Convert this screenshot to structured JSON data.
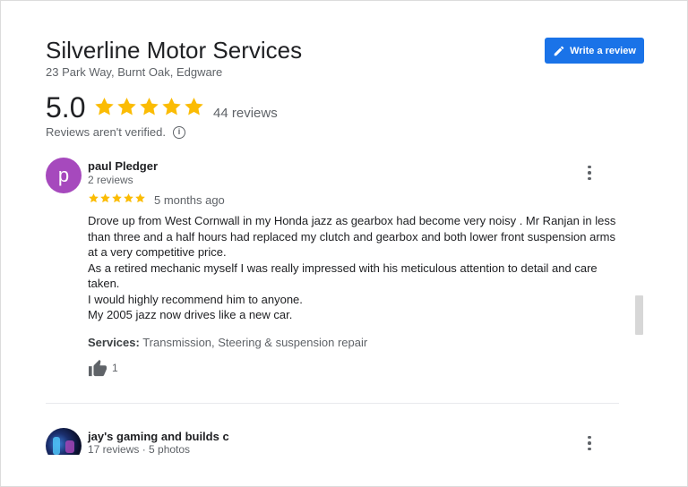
{
  "business": {
    "name": "Silverline Motor Services",
    "address": "23 Park Way, Burnt Oak, Edgware",
    "write_review_label": "Write a review",
    "rating": "5.0",
    "stars": 5,
    "review_count": "44 reviews",
    "not_verified": "Reviews aren't verified."
  },
  "reviews": [
    {
      "avatar_letter": "p",
      "avatar_color": "#a649bd",
      "name": "paul Pledger",
      "meta": "2 reviews",
      "stars": 5,
      "date": "5 months ago",
      "body": [
        "Drove up from West Cornwall in my Honda jazz as gearbox had become very noisy . Mr Ranjan in less than three and a half hours had replaced my clutch and gearbox and both lower front suspension arms at a very competitive price.",
        "As a retired mechanic myself I was really impressed with his meticulous attention to detail and care taken.",
        "I would highly recommend him to anyone.",
        "My 2005 jazz now drives like a new car."
      ],
      "services_label": "Services:",
      "services_value": "Transmission, Steering & suspension repair",
      "likes": "1"
    },
    {
      "name": "jay's gaming and builds c",
      "meta": "17 reviews · 5 photos"
    }
  ],
  "colors": {
    "accent": "#1a73e8",
    "star": "#fbbc04",
    "text": "#202124",
    "muted": "#5f6368"
  },
  "icons": {
    "write": "pencil-icon",
    "star": "star-icon",
    "info": "info-icon",
    "more": "more-vert-icon",
    "like": "thumbs-up-icon"
  }
}
